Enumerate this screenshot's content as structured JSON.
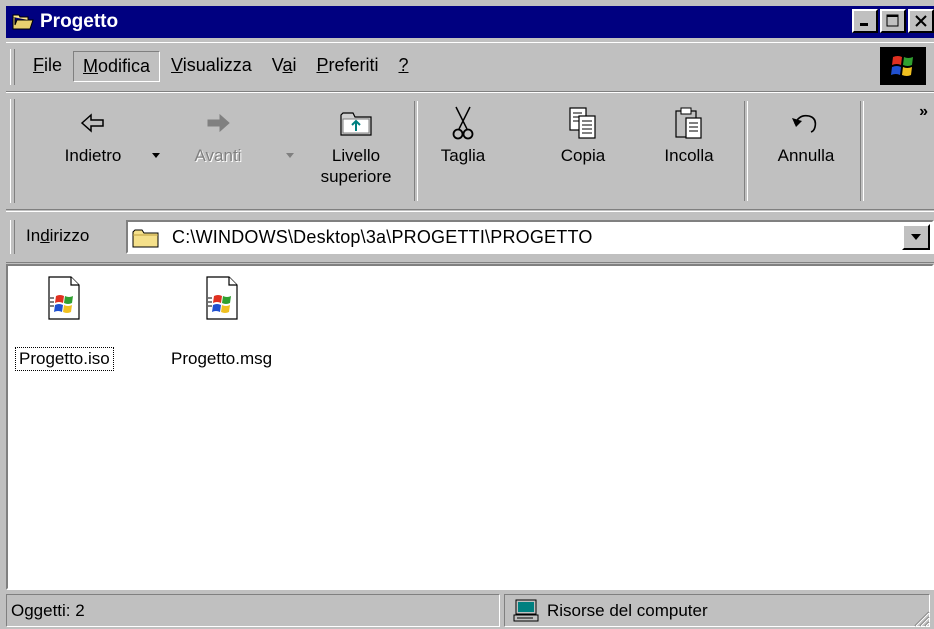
{
  "window": {
    "title": "Progetto",
    "buttons": [
      "minimize-icon",
      "maximize-icon",
      "close-icon"
    ]
  },
  "menubar": {
    "items": [
      {
        "label": "File",
        "underline": "F"
      },
      {
        "label": "Modifica",
        "underline": "M"
      },
      {
        "label": "Visualizza",
        "underline": "V"
      },
      {
        "label": "Vai",
        "underline": "a"
      },
      {
        "label": "Preferiti",
        "underline": "P"
      },
      {
        "label": "?",
        "underline": "?"
      }
    ],
    "active_index": 1
  },
  "toolbar": {
    "back_label": "Indietro",
    "forward_label": "Avanti",
    "up_label_1": "Livello",
    "up_label_2": "superiore",
    "cut_label": "Taglia",
    "copy_label": "Copia",
    "paste_label": "Incolla",
    "undo_label": "Annulla",
    "more": "»"
  },
  "address": {
    "label": "Indirizzo",
    "value": "C:\\WINDOWS\\Desktop\\3a\\PROGETTI\\PROGETTO"
  },
  "files": [
    {
      "name": "Progetto.iso",
      "icon": "windows-document-icon",
      "selected": true
    },
    {
      "name": "Progetto.msg",
      "icon": "windows-document-icon",
      "selected": false
    }
  ],
  "status": {
    "objects": "Oggetti: 2",
    "zone": "Risorse del computer"
  },
  "colors": {
    "titlebar": "#000080",
    "face": "#c0c0c0"
  }
}
